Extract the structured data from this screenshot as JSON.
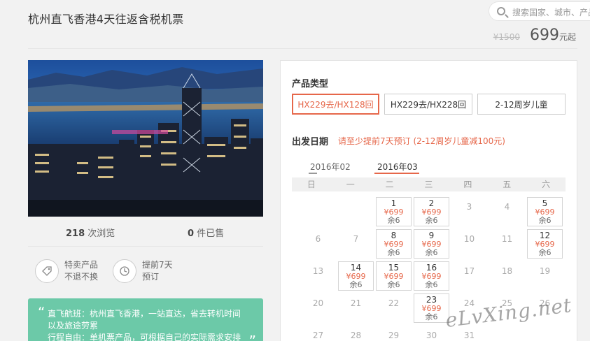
{
  "page": {
    "title": "杭州直飞香港4天往返含税机票",
    "search_placeholder": "搜索国家、城市、产品",
    "orig_price": "¥1500",
    "price": "699",
    "price_suffix": "元起"
  },
  "stats": {
    "views_num": "218",
    "views_label": "次浏览",
    "sold_num": "0",
    "sold_label": "件已售"
  },
  "features": [
    {
      "icon": "tag-icon",
      "line1": "特卖产品",
      "line2": "不退不换"
    },
    {
      "icon": "clock-icon",
      "line1": "提前7天",
      "line2": "预订"
    }
  ],
  "note": {
    "line1": "直飞航班：杭州直飞香港，一站直达，省去转机时间",
    "line2": "以及旅途劳累",
    "line3": "行程自由：单机票产品，可根据自己的实际需求安排"
  },
  "booking": {
    "type_label": "产品类型",
    "types": [
      "HX229去/HX128回",
      "HX229去/HX228回",
      "2-12周岁儿童"
    ],
    "active_type": 0,
    "date_label": "出发日期",
    "notice": "请至少提前7天预订   (2-12周岁儿童减100元)",
    "months": [
      "2016年02",
      "2016年03"
    ],
    "active_month": 1,
    "weekdays": [
      "日",
      "一",
      "二",
      "三",
      "四",
      "五",
      "六"
    ]
  },
  "calendar": {
    "first_weekday": 2,
    "days": [
      {
        "day": "1",
        "price": "¥699",
        "remain": "余6"
      },
      {
        "day": "2",
        "price": "¥699",
        "remain": "余6"
      },
      {
        "day": "3"
      },
      {
        "day": "4"
      },
      {
        "day": "5",
        "price": "¥699",
        "remain": "余6"
      },
      {
        "day": "6"
      },
      {
        "day": "7"
      },
      {
        "day": "8",
        "price": "¥699",
        "remain": "余6"
      },
      {
        "day": "9",
        "price": "¥699",
        "remain": "余6"
      },
      {
        "day": "10"
      },
      {
        "day": "11"
      },
      {
        "day": "12",
        "price": "¥699",
        "remain": "余6"
      },
      {
        "day": "13"
      },
      {
        "day": "14",
        "price": "¥699",
        "remain": "余6"
      },
      {
        "day": "15",
        "price": "¥699",
        "remain": "余6"
      },
      {
        "day": "16",
        "price": "¥699",
        "remain": "余6"
      },
      {
        "day": "17"
      },
      {
        "day": "18"
      },
      {
        "day": "19"
      },
      {
        "day": "20"
      },
      {
        "day": "21"
      },
      {
        "day": "22"
      },
      {
        "day": "23",
        "price": "¥699",
        "remain": "余6"
      },
      {
        "day": "24"
      },
      {
        "day": "25"
      },
      {
        "day": "26"
      },
      {
        "day": "27"
      },
      {
        "day": "28"
      },
      {
        "day": "29"
      },
      {
        "day": "30"
      },
      {
        "day": "31"
      }
    ]
  },
  "watermark": "eLvXing.net"
}
